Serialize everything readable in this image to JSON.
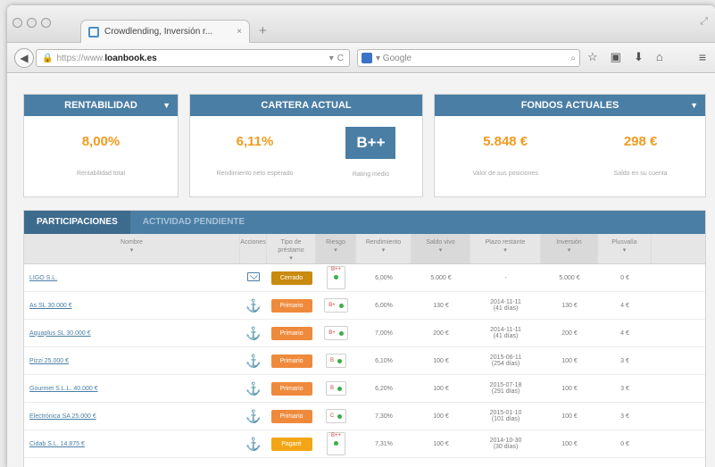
{
  "browser": {
    "tab_title": "Crowdlending, Inversión r...",
    "tab_close": "×",
    "new_tab": "+",
    "url_scheme": "https://www.",
    "url_host": "loanbook.es",
    "url_drop": "▾",
    "url_reload": "C",
    "search_engine_label": "▾ Google",
    "search_icon": "⌕",
    "toolbar_icons": [
      "☆",
      "▣",
      "⬇",
      "⌂"
    ],
    "menu_icon": "≡",
    "resize_icon": "⤢",
    "back_icon": "◀"
  },
  "cards": {
    "rentabilidad": {
      "title": "RENTABILIDAD",
      "value": "8,00%",
      "label": "Rentabilidad total"
    },
    "cartera": {
      "title": "CARTERA ACTUAL",
      "value": "6,11%",
      "label": "Rendimiento neto esperado",
      "rating": "B++",
      "rating_label": "Rating medio"
    },
    "fondos": {
      "title": "FONDOS ACTUALES",
      "value1": "5.848 €",
      "label1": "Valor de sus posiciones",
      "value2": "298 €",
      "label2": "Saldo en su cuenta"
    }
  },
  "panel": {
    "tabs": [
      "PARTICIPACIONES",
      "ACTIVIDAD PENDIENTE"
    ],
    "headers": [
      "Nombre",
      "Acciones",
      "Tipo de préstamo",
      "Riesgo",
      "Rendimiento",
      "Saldo vivo",
      "Plazo restante",
      "Inversión",
      "Plusvalía"
    ],
    "rows": [
      {
        "name": "LIGO S.L.",
        "action": "mail",
        "type": "Cerrado",
        "type_color": "#c98a10",
        "risk": "B++",
        "risk_tall": true,
        "rent": "6,00%",
        "saldo": "5.000 €",
        "plazo1": "-",
        "plazo2": "",
        "inv": "5.000 €",
        "plus": "0 €"
      },
      {
        "name": "As SL 30.000 €",
        "action": "download",
        "type": "Primario",
        "type_color": "#ef8a3c",
        "risk": "B+",
        "risk_tall": false,
        "rent": "6,00%",
        "saldo": "130 €",
        "plazo1": "2014-11-11",
        "plazo2": "(41 días)",
        "inv": "130 €",
        "plus": "4 €"
      },
      {
        "name": "Aquaplus SL 30.000 €",
        "action": "download",
        "type": "Primario",
        "type_color": "#ef8a3c",
        "risk": "B+",
        "risk_tall": false,
        "rent": "7,00%",
        "saldo": "200 €",
        "plazo1": "2014-11-11",
        "plazo2": "(41 días)",
        "inv": "200 €",
        "plus": "4 €"
      },
      {
        "name": "Pizzi 25.000 €",
        "action": "download",
        "type": "Primario",
        "type_color": "#ef8a3c",
        "risk": "B",
        "risk_tall": false,
        "rent": "6,10%",
        "saldo": "100 €",
        "plazo1": "2015-06-11",
        "plazo2": "(254 días)",
        "inv": "100 €",
        "plus": "3 €"
      },
      {
        "name": "Gourmet S.L.L. 40.000 €",
        "action": "download",
        "type": "Primario",
        "type_color": "#ef8a3c",
        "risk": "B",
        "risk_tall": false,
        "rent": "6,20%",
        "saldo": "100 €",
        "plazo1": "2015-07-18",
        "plazo2": "(291 días)",
        "inv": "100 €",
        "plus": "3 €"
      },
      {
        "name": "Electrónica SA 25.000 €",
        "action": "download",
        "type": "Primario",
        "type_color": "#ef8a3c",
        "risk": "C",
        "risk_tall": false,
        "rent": "7,30%",
        "saldo": "100 €",
        "plazo1": "2015-01-10",
        "plazo2": "(101 días)",
        "inv": "100 €",
        "plus": "3 €"
      },
      {
        "name": "Cidab S.L. 14.875 €",
        "action": "download",
        "type": "Pagaré",
        "type_color": "#f2a615",
        "risk": "B++",
        "risk_tall": true,
        "rent": "7,31%",
        "saldo": "100 €",
        "plazo1": "2014-10-30",
        "plazo2": "(30 días)",
        "inv": "100 €",
        "plus": "0 €"
      }
    ]
  }
}
